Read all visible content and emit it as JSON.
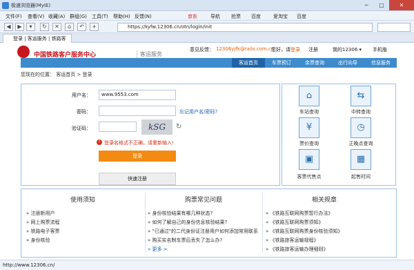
{
  "browser": {
    "title": "极速浏览器(MyIE)",
    "menu": [
      "文件(F)",
      "查看(V)",
      "收藏(A)",
      "群组(G)",
      "工具(T)",
      "帮助(H)",
      "反馈(N)"
    ],
    "bookmarks": [
      "京东",
      "导航",
      "抢票",
      "百度",
      "爱淘宝",
      "百度"
    ],
    "url": "https://kyfw.12306.cn/otn/login/init",
    "tab_label": "登录 | 客运服务 | 铁路客",
    "status_url": "http://www.12306.cn/"
  },
  "site": {
    "brand": "中国铁路客户服务中心",
    "brand_sub": "客运服务",
    "feedback_label": "意见反馈：",
    "feedback_email": "12306yjfk@rails.com.cn",
    "greeting": "您好，请",
    "login_link": "登录",
    "register_link": "注册",
    "my12306": "我的12306 ▾",
    "mobile": "手机版",
    "nav": [
      "客运首页",
      "车票预订",
      "余票查询",
      "出行向导",
      "信息服务"
    ],
    "breadcrumb": "您现在的位置：  客运首页  >  登录"
  },
  "form": {
    "username_label": "用户名：",
    "username_value": "www.9553.com",
    "password_label": "密码：",
    "forgot": "忘记用户名/密码?",
    "captcha_label": "验证码：",
    "captcha_text": "kSG",
    "error": "登录名格式不正确，请重新输入!",
    "login_button": "登录",
    "register_button": "快速注册"
  },
  "quick": [
    {
      "label": "车站查询",
      "icon": "station-icon",
      "glyph": "⌂"
    },
    {
      "label": "中转查询",
      "icon": "transfer-icon",
      "glyph": "⇆"
    },
    {
      "label": "票价查询",
      "icon": "fare-icon",
      "glyph": "¥"
    },
    {
      "label": "正晚点查询",
      "icon": "clock-icon",
      "glyph": "◷"
    },
    {
      "label": "客票代售点",
      "icon": "agency-icon",
      "glyph": "▣"
    },
    {
      "label": "起售时间",
      "icon": "calendar-icon",
      "glyph": "▦"
    }
  ],
  "columns": [
    {
      "title": "使用须知",
      "items": [
        "注册新用户",
        "网上购票流程",
        "铁路电子客票",
        "身份核验"
      ]
    },
    {
      "title": "购票常见问题",
      "items": [
        "身份核验结果有哪几种状态?",
        "如何了解自己的身份信息核验结果?",
        "\"已通过\"的二代身份证注册用户如何添加常用联系人?",
        "购买实名制车票后丢失了怎么办?",
        "更多 >"
      ]
    },
    {
      "title": "相关规章",
      "items": [
        "《铁路互联网购票暂行办法》",
        "《铁路互联网购票须知》",
        "《铁路互联网购票身份核验须知》",
        "《铁路旅客运输规程》",
        "《铁路旅客运输办理细则》"
      ]
    }
  ]
}
